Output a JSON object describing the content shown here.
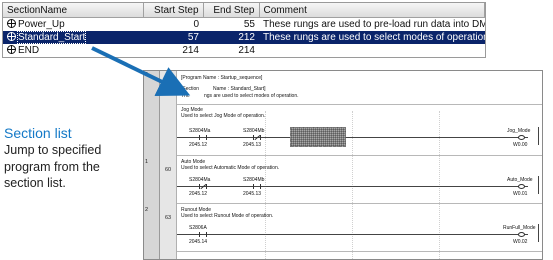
{
  "section_table": {
    "columns": [
      "SectionName",
      "Start Step",
      "End Step",
      "Comment"
    ],
    "rows": [
      {
        "name": "Power_Up",
        "start": "0",
        "end": "55",
        "comment": "These rungs are used to pre-load run data into DM area."
      },
      {
        "name": "Standard_Start",
        "start": "57",
        "end": "212",
        "comment": "These rungs are used to select modes of operation."
      },
      {
        "name": "END",
        "start": "214",
        "end": "214",
        "comment": ""
      }
    ]
  },
  "callout": {
    "title": "Section list",
    "line1": "Jump to specified",
    "line2": "program from the",
    "line3": "section list."
  },
  "ladder": {
    "header": {
      "rung": "0",
      "step": "57",
      "program_name": "[Program Name : Startup_sequence]",
      "section_name_prefix": "[Section",
      "section_name_rest": "Name : Standard_Start]",
      "comment_prefix": "The",
      "comment_rest": "ngs are used to select modes of operation."
    },
    "rungs": [
      {
        "rung": "0",
        "step": "",
        "title": "Jog Mode",
        "subtitle": "Used to select Jog Mode of operation.",
        "c1_name": "S2804Ma",
        "c1_addr": "2045.12",
        "c2_name": "S2804Mb",
        "c2_addr": "2045.13",
        "coil_name": "Jog_Mode",
        "coil_addr": "W0.00"
      },
      {
        "rung": "1",
        "step": "60",
        "title": "Auto Mode",
        "subtitle": "Used to select Automatic Mode of operation.",
        "c1_name": "S2804Ma",
        "c1_addr": "2045.12",
        "c2_name": "S2804Mb",
        "c2_addr": "2045.13",
        "coil_name": "Auto_Mode",
        "coil_addr": "W0.01"
      },
      {
        "rung": "2",
        "step": "63",
        "title": "Runout Mode",
        "subtitle": "Used to select Runout Mode of operation.",
        "c1_name": "S2806A",
        "c1_addr": "2045.14",
        "coil_name": "RunFull_Mode",
        "coil_addr": "W0.02"
      }
    ]
  },
  "colors": {
    "selection": "#0a246a",
    "callout_title": "#1479c7",
    "arrow": "#1a6fb5"
  },
  "icons": {
    "section_icon": "section-crosshair-icon"
  }
}
